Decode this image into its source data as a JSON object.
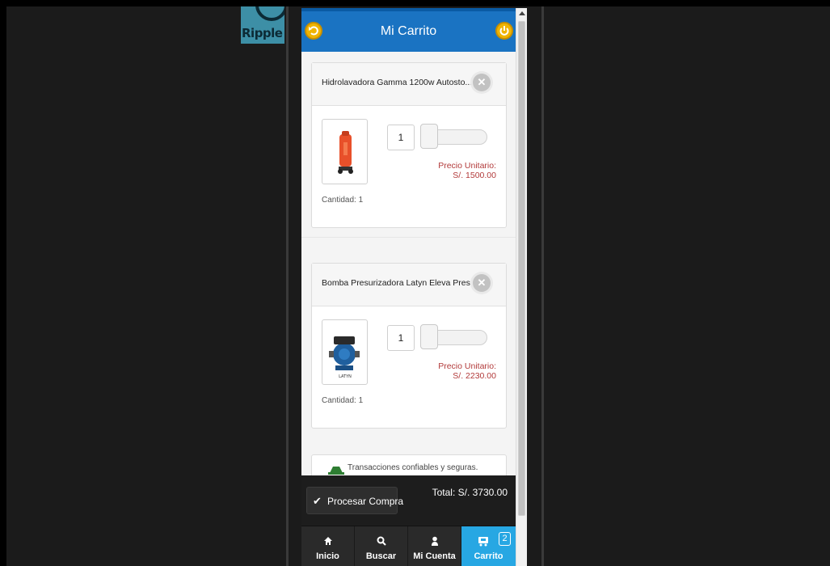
{
  "brand": {
    "logo_text": "Ripple"
  },
  "header": {
    "title": "Mi Carrito",
    "back_icon": "back-arrow-icon",
    "power_icon": "power-icon"
  },
  "cart": {
    "items": [
      {
        "name": "Hidrolavadora Gamma 1200w Autosto...",
        "quantity_value": "1",
        "price_label": "Precio Unitario:",
        "price_value": "S/. 1500.00",
        "quantity_text": "Cantidad: 1",
        "slider_level": 0
      },
      {
        "name": "Bomba Presurizadora Latyn Eleva Pres...",
        "quantity_value": "1",
        "price_label": "Precio Unitario:",
        "price_value": "S/. 2230.00",
        "quantity_text": "Cantidad: 1",
        "product_brand": "LATYN",
        "slider_level": 0
      }
    ],
    "trust_text": "Transacciones confiables y seguras."
  },
  "footer": {
    "process_label": "Procesar Compra",
    "total": "Total: S/. 3730.00"
  },
  "nav": {
    "items": [
      {
        "label": "Inicio",
        "icon": "home-icon"
      },
      {
        "label": "Buscar",
        "icon": "search-icon"
      },
      {
        "label": "Mi Cuenta",
        "icon": "user-icon"
      },
      {
        "label": "Carrito",
        "icon": "cart-icon",
        "badge": "2",
        "active": true
      }
    ]
  },
  "colors": {
    "header": "#1a73c2",
    "accent": "#27a7e3",
    "price": "#b23a3a",
    "button_yellow": "#f0b400"
  }
}
